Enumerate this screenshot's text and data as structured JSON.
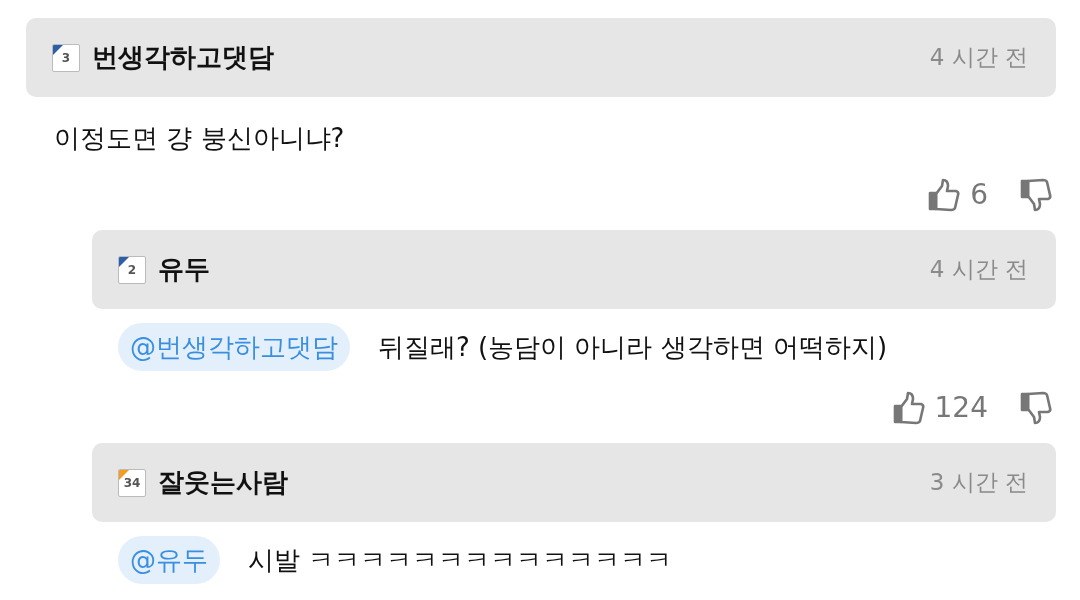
{
  "comments": [
    {
      "level": "3",
      "color": "#2b5fa8",
      "author": "번생각하고댓담",
      "time": "4 시간 전",
      "text": "이정도면 걍 붕신아니냐?",
      "likes": "6",
      "reply": false
    },
    {
      "level": "2",
      "color": "#2b5fa8",
      "author": "유두",
      "time": "4 시간 전",
      "mention": "@번생각하고댓담",
      "text": "뒤질래? (농담이 아니라 생각하면 어떡하지)",
      "likes": "124",
      "reply": true
    },
    {
      "level": "34",
      "color": "#f39c1f",
      "author": "잘웃는사람",
      "time": "3 시간 전",
      "mention": "@유두",
      "text": "시발 ㅋㅋㅋㅋㅋㅋㅋㅋㅋㅋㅋㅋㅋㅋ",
      "reply": true
    }
  ]
}
